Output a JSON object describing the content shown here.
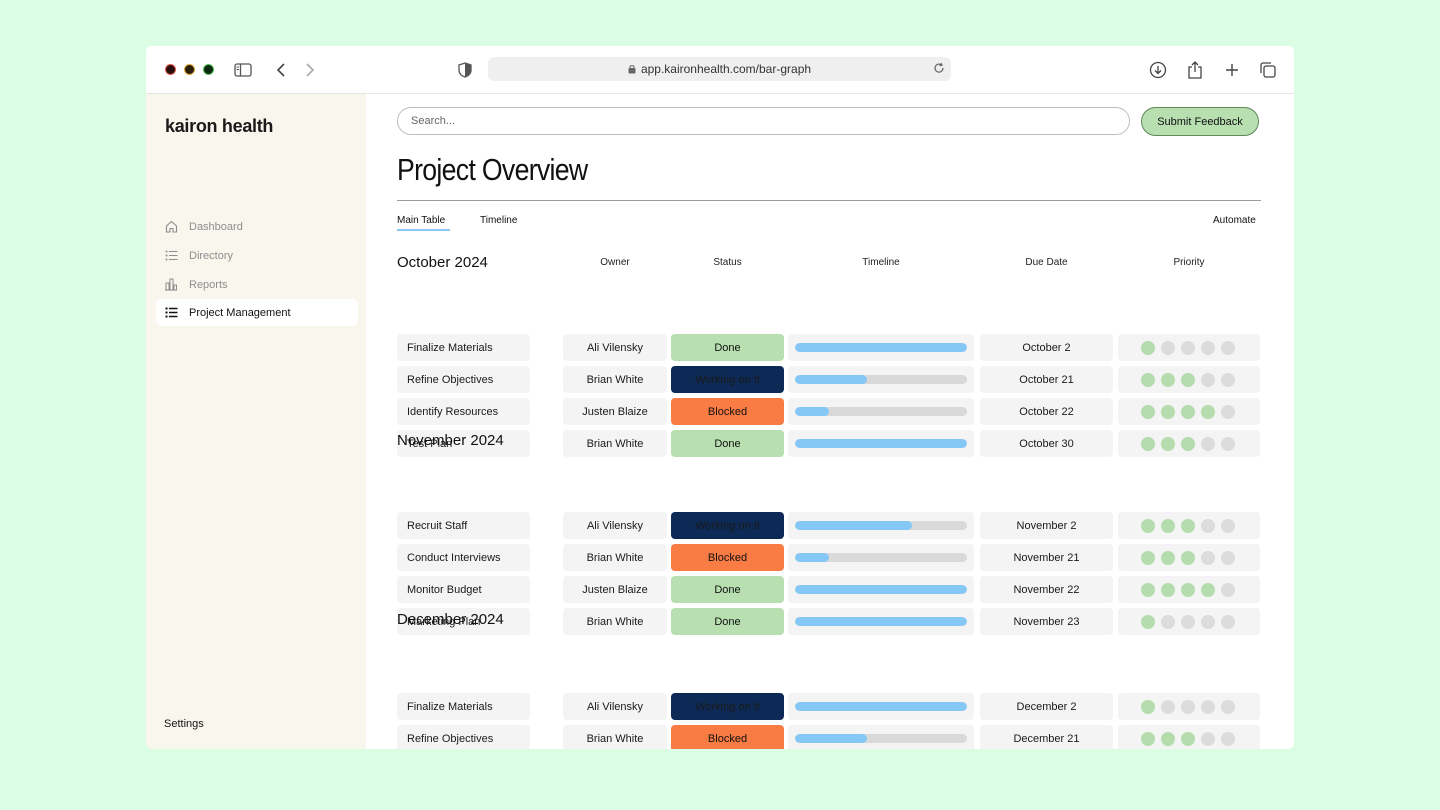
{
  "browser": {
    "url": "app.kaironhealth.com/bar-graph"
  },
  "sidebar": {
    "brand": "kairon health",
    "items": [
      {
        "label": "Dashboard",
        "icon": "home-icon"
      },
      {
        "label": "Directory",
        "icon": "list-icon"
      },
      {
        "label": "Reports",
        "icon": "bar-chart-icon"
      },
      {
        "label": "Project Management",
        "icon": "list-icon",
        "active": true
      }
    ],
    "settings_label": "Settings"
  },
  "header": {
    "search_placeholder": "Search...",
    "feedback_label": "Submit Feedback",
    "title": "Project Overview"
  },
  "tabs": {
    "main_table": "Main Table",
    "timeline": "Timeline",
    "automate": "Automate"
  },
  "columns": {
    "owner": "Owner",
    "status": "Status",
    "timeline": "Timeline",
    "due_date": "Due Date",
    "priority": "Priority"
  },
  "colors": {
    "done": "#b8dfb0",
    "working": "#0d2a56",
    "blocked": "#f87c44",
    "progress": "#86c8f5",
    "priority_on": "#b4dcac"
  },
  "groups": [
    {
      "title": "October 2024",
      "rows": [
        {
          "name": "Finalize Materials",
          "owner": "Ali Vilensky",
          "status": "Done",
          "progress": 1.0,
          "due": "October 2",
          "priority": 1
        },
        {
          "name": "Refine Objectives",
          "owner": "Brian White",
          "status": "Working on It",
          "progress": 0.42,
          "due": "October 21",
          "priority": 3
        },
        {
          "name": "Identify Resources",
          "owner": "Justen Blaize",
          "status": "Blocked",
          "progress": 0.2,
          "due": "October 22",
          "priority": 4
        },
        {
          "name": "Test Plan",
          "owner": "Brian White",
          "status": "Done",
          "progress": 1.0,
          "due": "October 30",
          "priority": 3
        }
      ]
    },
    {
      "title": "November 2024",
      "rows": [
        {
          "name": "Recruit Staff",
          "owner": "Ali Vilensky",
          "status": "Working on It",
          "progress": 0.68,
          "due": "November 2",
          "priority": 3
        },
        {
          "name": "Conduct Interviews",
          "owner": "Brian White",
          "status": "Blocked",
          "progress": 0.2,
          "due": "November 21",
          "priority": 3
        },
        {
          "name": "Monitor Budget",
          "owner": "Justen Blaize",
          "status": "Done",
          "progress": 1.0,
          "due": "November 22",
          "priority": 4
        },
        {
          "name": "Marketing Plan",
          "owner": "Brian White",
          "status": "Done",
          "progress": 1.0,
          "due": "November 23",
          "priority": 1
        }
      ]
    },
    {
      "title": "December 2024",
      "rows": [
        {
          "name": "Finalize Materials",
          "owner": "Ali Vilensky",
          "status": "Working on It",
          "progress": 1.0,
          "due": "December 2",
          "priority": 1
        },
        {
          "name": "Refine Objectives",
          "owner": "Brian White",
          "status": "Blocked",
          "progress": 0.42,
          "due": "December 21",
          "priority": 3
        }
      ]
    }
  ]
}
